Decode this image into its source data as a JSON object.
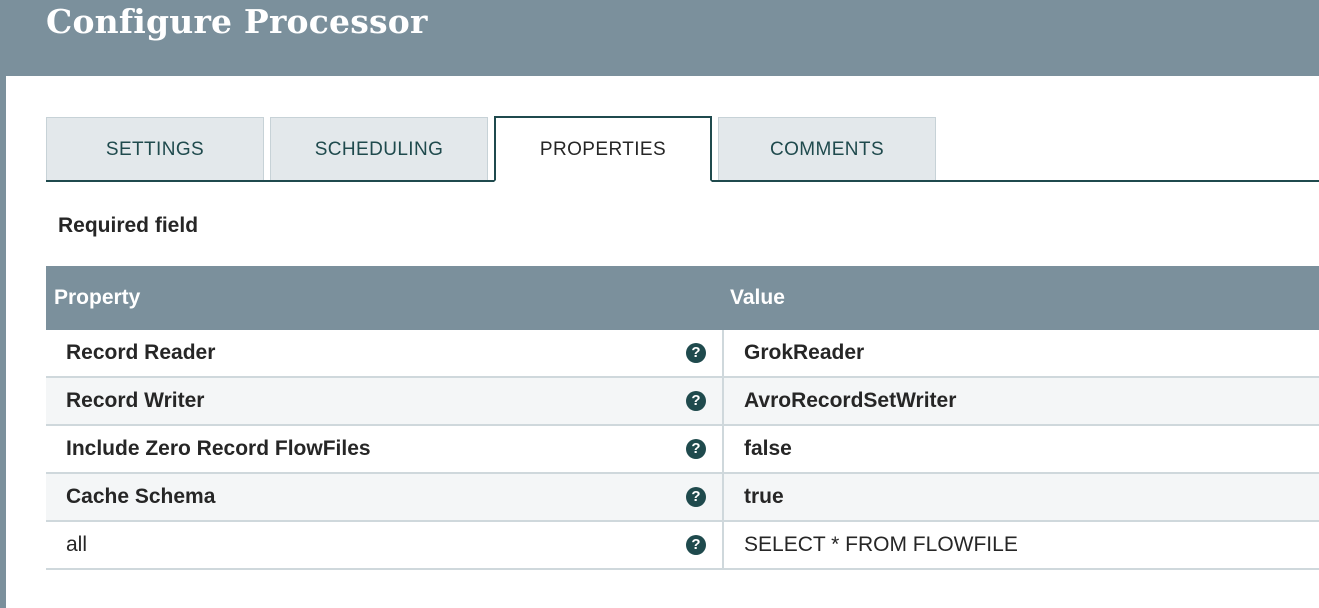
{
  "dialog": {
    "title": "Configure Processor"
  },
  "tabs": [
    {
      "label": "SETTINGS",
      "active": false
    },
    {
      "label": "SCHEDULING",
      "active": false
    },
    {
      "label": "PROPERTIES",
      "active": true
    },
    {
      "label": "COMMENTS",
      "active": false
    }
  ],
  "properties": {
    "required_label": "Required field",
    "columns": {
      "property": "Property",
      "value": "Value"
    },
    "help_glyph": "?",
    "rows": [
      {
        "name": "Record Reader",
        "value": "GrokReader",
        "required": true
      },
      {
        "name": "Record Writer",
        "value": "AvroRecordSetWriter",
        "required": true
      },
      {
        "name": "Include Zero Record FlowFiles",
        "value": "false",
        "required": true
      },
      {
        "name": "Cache Schema",
        "value": "true",
        "required": true
      },
      {
        "name": "all",
        "value": "SELECT * FROM FLOWFILE",
        "required": false
      }
    ]
  },
  "icons": {
    "help": "question-circle-icon"
  },
  "colors": {
    "header_bg": "#7b909c",
    "accent": "#1f4a4d",
    "tab_inactive_bg": "#e3e8eb",
    "row_alt_bg": "#f4f6f7"
  }
}
